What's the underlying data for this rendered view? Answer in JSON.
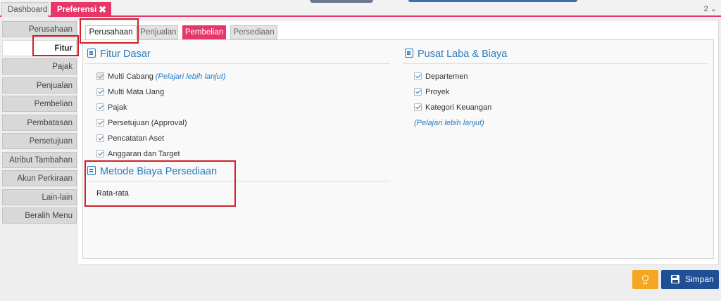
{
  "top_tabs": {
    "dashboard": "Dashboard",
    "preferensi": "Preferensi",
    "close_glyph": "✖",
    "window_selector": "2 ⌄"
  },
  "side_menu": [
    {
      "label": "Perusahaan",
      "active": false
    },
    {
      "label": "Fitur",
      "active": true
    },
    {
      "label": "Pajak",
      "active": false
    },
    {
      "label": "Penjualan",
      "active": false
    },
    {
      "label": "Pembelian",
      "active": false
    },
    {
      "label": "Pembatasan",
      "active": false
    },
    {
      "label": "Persetujuan",
      "active": false
    },
    {
      "label": "Atribut Tambahan",
      "active": false
    },
    {
      "label": "Akun Perkiraan",
      "active": false
    },
    {
      "label": "Lain-lain",
      "active": false
    },
    {
      "label": "Beralih Menu",
      "active": false
    }
  ],
  "sub_tabs": {
    "perusahaan": "Perusahaan",
    "penjualan": "Penjualan",
    "pembelian": "Pembelian",
    "persediaan": "Persediaan"
  },
  "fitur_dasar": {
    "title": "Fitur Dasar",
    "items": [
      {
        "label": "Multi Cabang",
        "checked": true,
        "disabled": true,
        "link": "(Pelajari lebih lanjut)"
      },
      {
        "label": "Multi Mata Uang",
        "checked": true
      },
      {
        "label": "Pajak",
        "checked": true
      },
      {
        "label": "Persetujuan (Approval)",
        "checked": true
      },
      {
        "label": "Pencatatan Aset",
        "checked": true
      },
      {
        "label": "Anggaran dan Target",
        "checked": true
      }
    ]
  },
  "pusat_laba": {
    "title": "Pusat Laba & Biaya",
    "items": [
      {
        "label": "Departemen",
        "checked": true
      },
      {
        "label": "Proyek",
        "checked": true
      },
      {
        "label": "Kategori Keuangan",
        "checked": true
      }
    ],
    "link": "(Pelajari lebih lanjut)"
  },
  "metode_biaya": {
    "title": "Metode Biaya Persediaan",
    "value": "Rata-rata"
  },
  "buttons": {
    "save": "Simpan"
  },
  "colors": {
    "accent_pink": "#e8356a",
    "link_blue": "#2a7ac0",
    "save_blue": "#1f4f95",
    "bulb_orange": "#f5a623",
    "annotation_red": "#d0202a"
  },
  "icons": [
    "close-icon",
    "document-icon",
    "building-icon",
    "lightbulb-icon",
    "floppy-disk-icon",
    "checkbox-icon"
  ]
}
